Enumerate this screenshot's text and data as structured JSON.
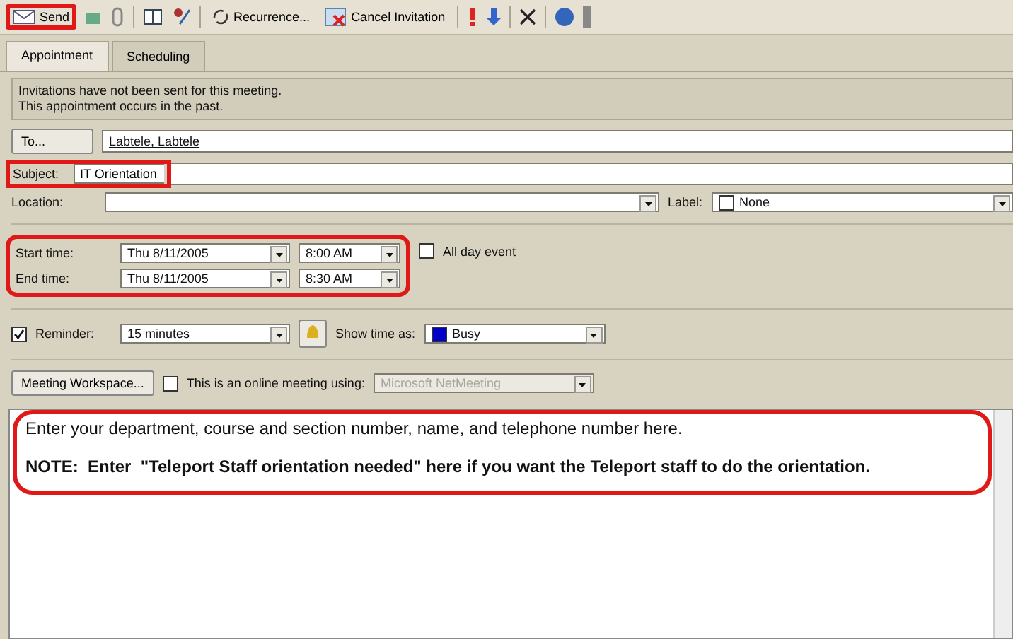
{
  "toolbar": {
    "send": "Send",
    "recurrence": "Recurrence...",
    "cancel": "Cancel Invitation"
  },
  "tabs": [
    {
      "label": "Appointment",
      "selected": true
    },
    {
      "label": "Scheduling",
      "selected": false
    }
  ],
  "info": [
    "Invitations have not been sent for this meeting.",
    "This appointment occurs in the past."
  ],
  "to": {
    "button": "To...",
    "value": "Labtele, Labtele"
  },
  "subject": {
    "label": "Subject:",
    "value": "IT Orientation"
  },
  "location": {
    "label": "Location:"
  },
  "label": {
    "label": "Label:",
    "value": "None"
  },
  "times": [
    {
      "label": "Start time:",
      "date": "Thu 8/11/2005",
      "time": "8:00 AM"
    },
    {
      "label": "End time:",
      "date": "Thu 8/11/2005",
      "time": "8:30 AM"
    }
  ],
  "all_day": {
    "label": "All day event",
    "checked": false
  },
  "reminder": {
    "label": "Reminder:",
    "checked": true,
    "value": "15 minutes"
  },
  "show_time_as": {
    "label": "Show time as:",
    "value": "Busy"
  },
  "workspace": {
    "button": "Meeting Workspace...",
    "online_label": "This is an online meeting using:",
    "online_checked": false,
    "online_value": "Microsoft NetMeeting",
    "online_disabled": true
  },
  "body": [
    {
      "text": "Enter your department, course and section number, name, and telephone number here.",
      "bold": false
    },
    {
      "text": "NOTE:  Enter  \"Teleport Staff orientation needed\" here if you want the Teleport staff to do the orientation.",
      "bold": true
    }
  ]
}
